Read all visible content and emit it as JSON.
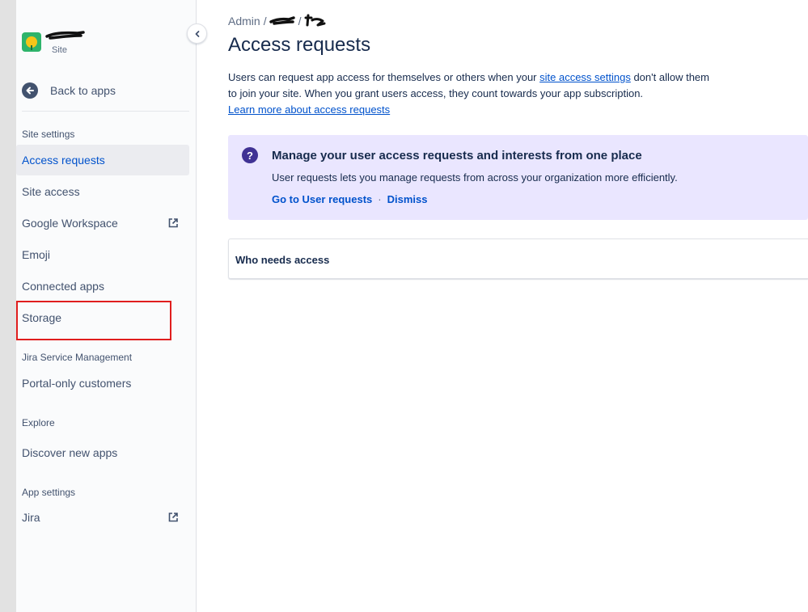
{
  "sidebar": {
    "site_subtitle": "Site",
    "back_label": "Back to apps",
    "groups": [
      {
        "title": "Site settings"
      },
      {
        "title": "Jira Service Management"
      },
      {
        "title": "Explore"
      },
      {
        "title": "App settings"
      }
    ],
    "items": [
      {
        "label": "Access requests",
        "active": true
      },
      {
        "label": "Site access"
      },
      {
        "label": "Google Workspace",
        "external": true
      },
      {
        "label": "Emoji"
      },
      {
        "label": "Connected apps"
      },
      {
        "label": "Storage",
        "highlighted": true
      },
      {
        "label": "Portal-only customers"
      },
      {
        "label": "Discover new apps"
      },
      {
        "label": "Jira",
        "external": true
      }
    ]
  },
  "breadcrumb": {
    "root": "Admin",
    "separator": "/"
  },
  "main": {
    "title": "Access requests",
    "intro_before_link": "Users can request app access for themselves or others when your ",
    "intro_link": "site access settings",
    "intro_after_link": " don't allow them to join your site. When you grant users access, they count towards your app subscription.",
    "learn_more": "Learn more about access requests"
  },
  "banner": {
    "icon": "question-icon",
    "title": "Manage your user access requests and interests from one place",
    "description": "User requests lets you manage requests from across your organization more efficiently.",
    "primary_action": "Go to User requests",
    "separator": "·",
    "secondary_action": "Dismiss"
  },
  "panel": {
    "title": "Who needs access"
  },
  "colors": {
    "accent": "#0052cc",
    "banner_bg": "#eae6ff",
    "banner_icon": "#403294",
    "highlight": "#e01e1e",
    "sidebar_bg": "#fafbfc"
  }
}
